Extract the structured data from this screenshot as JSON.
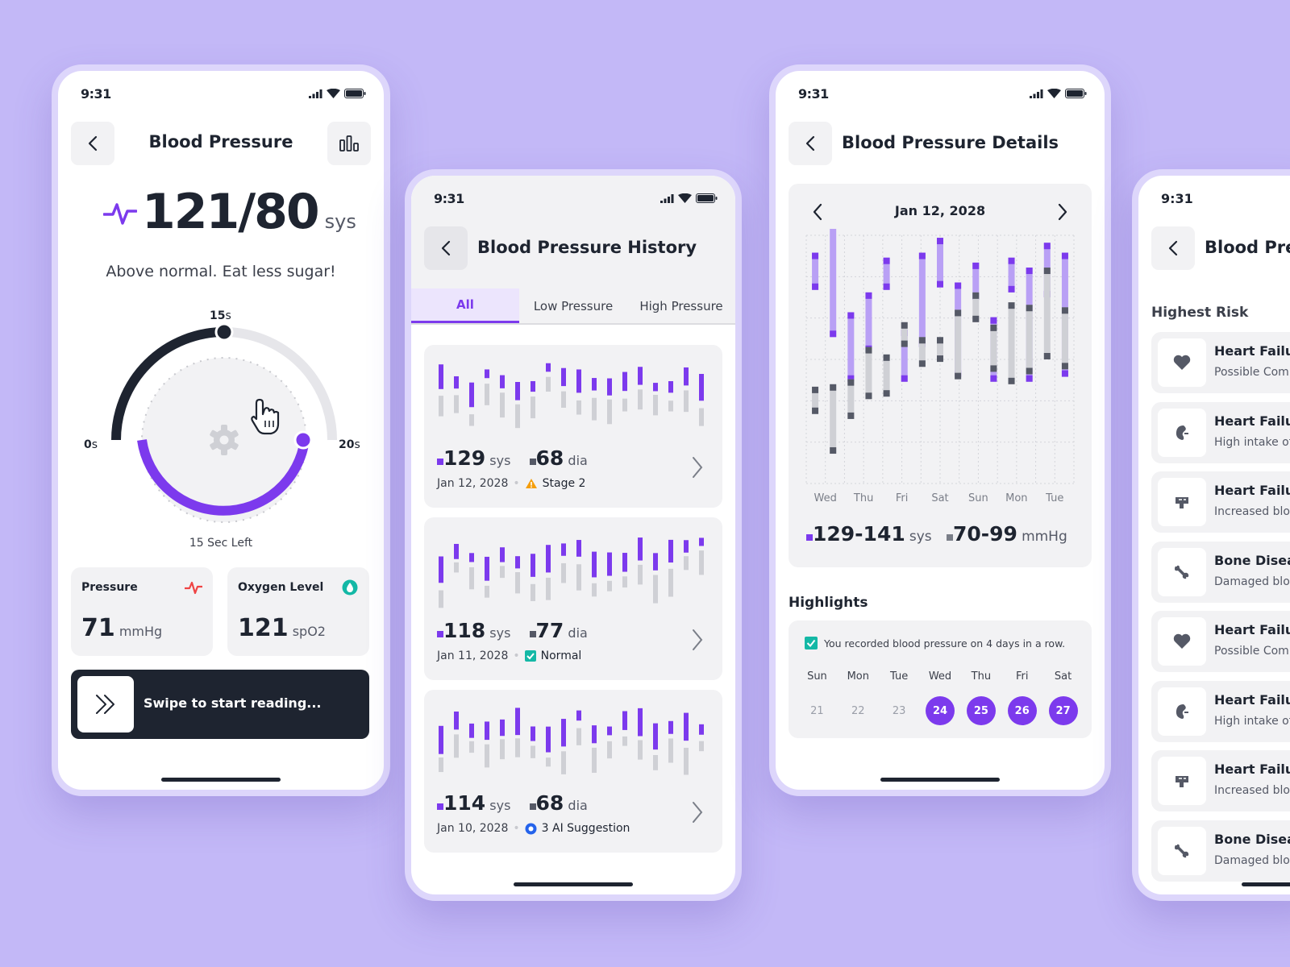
{
  "status_time": "9:31",
  "colors": {
    "accent": "#7c3aed",
    "accent_light": "#b9a0f5",
    "dark": "#1e2430",
    "grey_bar": "#cfd0d5",
    "grey_dark": "#555966",
    "bg": "#c3b8f7",
    "red": "#ef4444",
    "teal": "#14b8a6",
    "amber": "#f59e0b",
    "blue": "#2563eb"
  },
  "screen1": {
    "title": "Blood Pressure",
    "reading": "121/80",
    "reading_unit": "sys",
    "message": "Above normal. Eat less sugar!",
    "timer": {
      "min_label": "0",
      "mid_label": "15",
      "max_label": "20",
      "unit": "s",
      "left_label": "15 Sec Left",
      "progress": 0.75
    },
    "pressure": {
      "label": "Pressure",
      "value": "71",
      "unit": "mmHg"
    },
    "oxygen": {
      "label": "Oxygen Level",
      "value": "121",
      "unit": "spO2"
    },
    "swipe_label": "Swipe to start reading..."
  },
  "screen2": {
    "title": "Blood Pressure History",
    "tabs": [
      {
        "label": "All"
      },
      {
        "label": "Low Pressure"
      },
      {
        "label": "High Pressure"
      }
    ],
    "entries": [
      {
        "sys": "129",
        "sys_unit": "sys",
        "dia": "68",
        "dia_unit": "dia",
        "date": "Jan 12, 2028",
        "tag": "Stage 2",
        "tag_icon": "warning-icon"
      },
      {
        "sys": "118",
        "sys_unit": "sys",
        "dia": "77",
        "dia_unit": "dia",
        "date": "Jan 11, 2028",
        "tag": "Normal",
        "tag_icon": "check-icon"
      },
      {
        "sys": "114",
        "sys_unit": "sys",
        "dia": "68",
        "dia_unit": "dia",
        "date": "Jan 10, 2028",
        "tag": "3 AI Suggestion",
        "tag_icon": "ai-chip-icon"
      }
    ]
  },
  "screen3": {
    "title": "Blood Pressure Details",
    "chart_date": "Jan 12, 2028",
    "sys_range": "129-141",
    "sys_unit": "sys",
    "dia_range": "70-99",
    "dia_unit": "mmHg",
    "highlights_title": "Highlights",
    "highlight_text": "You recorded blood pressure on 4 days in a row.",
    "week": [
      {
        "day": "Sun",
        "date": "21",
        "active": false
      },
      {
        "day": "Mon",
        "date": "22",
        "active": false
      },
      {
        "day": "Tue",
        "date": "23",
        "active": false
      },
      {
        "day": "Wed",
        "date": "24",
        "active": true
      },
      {
        "day": "Thu",
        "date": "25",
        "active": true
      },
      {
        "day": "Fri",
        "date": "26",
        "active": true
      },
      {
        "day": "Sat",
        "date": "27",
        "active": true
      }
    ]
  },
  "screen4": {
    "title": "Blood Pres",
    "section": "Highest Risk",
    "items": [
      {
        "title": "Heart Failur",
        "sub": "Possible Comp",
        "icon": "heart-icon"
      },
      {
        "title": "Heart Failur",
        "sub": "High intake of",
        "icon": "kidney-icon"
      },
      {
        "title": "Heart Failur",
        "sub": "Increased bloo",
        "icon": "brain-icon"
      },
      {
        "title": "Bone Diseas",
        "sub": "Damaged bloo",
        "icon": "bone-icon"
      },
      {
        "title": "Heart Failur",
        "sub": "Possible Comp",
        "icon": "heart-icon"
      },
      {
        "title": "Heart Failur",
        "sub": "High intake of",
        "icon": "kidney-icon"
      },
      {
        "title": "Heart Failur",
        "sub": "Increased bloo",
        "icon": "brain-icon"
      },
      {
        "title": "Bone Diseas",
        "sub": "Damaged bloo",
        "icon": "bone-icon"
      }
    ]
  },
  "chart_data": [
    {
      "type": "bar",
      "title": "",
      "categories": [
        "Wed",
        "",
        "",
        "Thu",
        "",
        "",
        "Fri",
        "",
        "",
        "Sat",
        "",
        "",
        "Sun",
        "",
        "",
        "Mon",
        "",
        "",
        "Tue",
        ""
      ],
      "category_labels": [
        "Wed",
        "Thu",
        "Fri",
        "Sat",
        "Sun",
        "Mon",
        "Tue"
      ],
      "series": [
        {
          "name": "sys",
          "ranges": [
            [
              78,
              93
            ],
            [
              59,
              106
            ],
            [
              41,
              69
            ],
            [
              53,
              77
            ],
            [
              78,
              91
            ],
            [
              41,
              62
            ],
            [
              55,
              93
            ],
            [
              79,
              99
            ],
            [
              43,
              81
            ],
            [
              74,
              89
            ],
            [
              41,
              67
            ],
            [
              77,
              91
            ],
            [
              41,
              87
            ],
            [
              75,
              97
            ],
            [
              43,
              93
            ]
          ]
        },
        {
          "name": "dia",
          "ranges": [
            [
              28,
              39
            ],
            [
              12,
              40
            ],
            [
              26,
              42
            ],
            [
              34,
              55
            ],
            [
              35,
              52
            ],
            [
              55,
              65
            ],
            [
              47,
              59
            ],
            [
              49,
              59
            ],
            [
              42,
              70
            ],
            [
              65,
              77
            ],
            [
              45,
              64
            ],
            [
              40,
              73
            ],
            [
              44,
              72
            ],
            [
              50,
              87
            ],
            [
              46,
              71
            ]
          ]
        }
      ],
      "ylim": [
        0,
        100
      ]
    }
  ]
}
